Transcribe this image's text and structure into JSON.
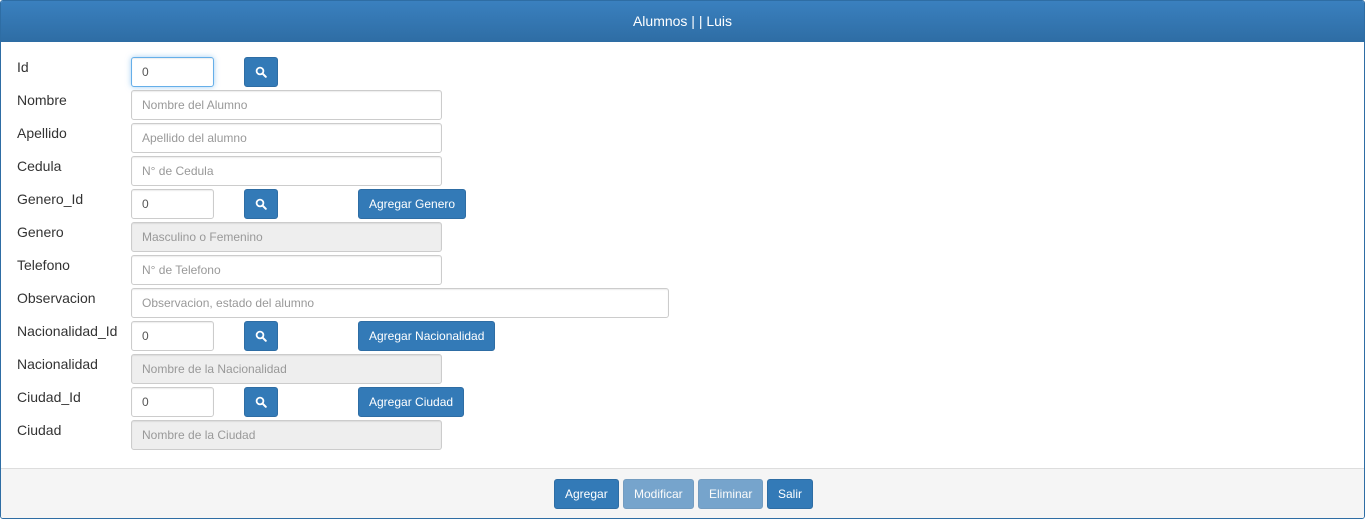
{
  "header": {
    "title": "Alumnos | | Luis"
  },
  "form": {
    "id": {
      "label": "Id",
      "value": "0"
    },
    "nombre": {
      "label": "Nombre",
      "placeholder": "Nombre del Alumno"
    },
    "apellido": {
      "label": "Apellido",
      "placeholder": "Apellido del alumno"
    },
    "cedula": {
      "label": "Cedula",
      "placeholder": "N° de Cedula"
    },
    "genero_id": {
      "label": "Genero_Id",
      "value": "0",
      "add_label": "Agregar Genero"
    },
    "genero": {
      "label": "Genero",
      "placeholder": "Masculino o Femenino"
    },
    "telefono": {
      "label": "Telefono",
      "placeholder": "N° de Telefono"
    },
    "observacion": {
      "label": "Observacion",
      "placeholder": "Observacion, estado del alumno"
    },
    "nacionalidad_id": {
      "label": "Nacionalidad_Id",
      "value": "0",
      "add_label": "Agregar Nacionalidad"
    },
    "nacionalidad": {
      "label": "Nacionalidad",
      "placeholder": "Nombre de la Nacionalidad"
    },
    "ciudad_id": {
      "label": "Ciudad_Id",
      "value": "0",
      "add_label": "Agregar Ciudad"
    },
    "ciudad": {
      "label": "Ciudad",
      "placeholder": "Nombre de la Ciudad"
    }
  },
  "footer": {
    "agregar": "Agregar",
    "modificar": "Modificar",
    "eliminar": "Eliminar",
    "salir": "Salir"
  },
  "icons": {
    "search": "search-icon"
  },
  "colors": {
    "primary": "#337ab7",
    "header": "#2e6da4",
    "readonly_bg": "#eeeeee"
  }
}
